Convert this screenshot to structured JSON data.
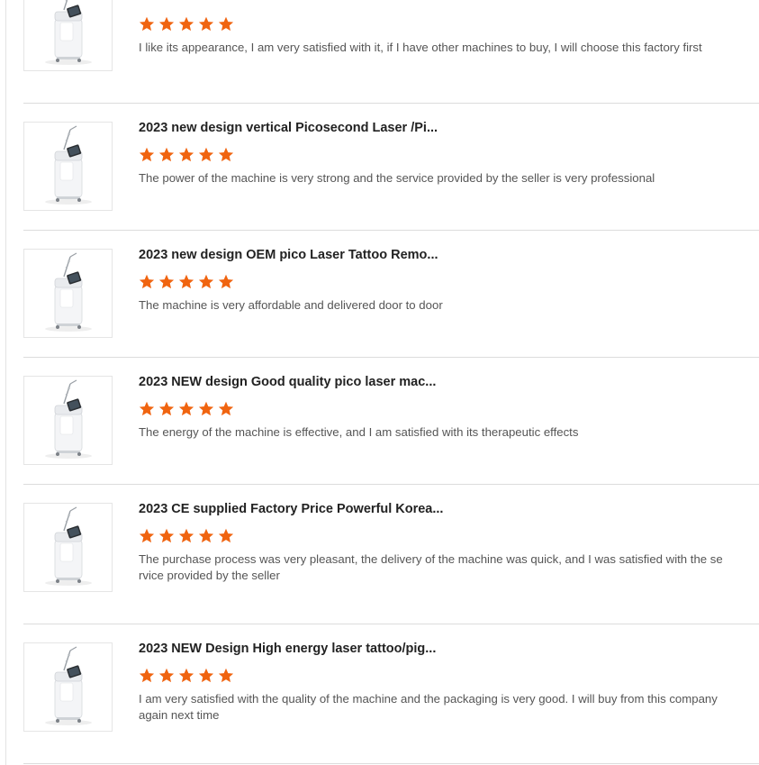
{
  "accent_color": "#f06410",
  "reviews": [
    {
      "title": "",
      "rating": 5,
      "comment": "I like its appearance, I am very satisfied with it, if I have other machines to buy, I will choose this factory first"
    },
    {
      "title": "2023 new design vertical Picosecond Laser /Pi...",
      "rating": 5,
      "comment": "The power of the machine is very strong and the service provided by the seller is very professional"
    },
    {
      "title": "2023 new design OEM pico Laser Tattoo Remo...",
      "rating": 5,
      "comment": "The machine is very affordable and delivered door to door"
    },
    {
      "title": "2023 NEW design Good quality pico laser mac...",
      "rating": 5,
      "comment": "The energy of the machine is effective, and I am satisfied with its therapeutic effects"
    },
    {
      "title": "2023 CE supplied Factory Price Powerful Korea...",
      "rating": 5,
      "comment": "The purchase process was very pleasant, the delivery of the machine was quick, and I was satisfied with the service provided by the seller"
    },
    {
      "title": "2023 NEW Design High energy laser tattoo/pig...",
      "rating": 5,
      "comment": "I am very satisfied with the quality of the machine and the packaging is very good. I will buy from this company again next time"
    }
  ]
}
